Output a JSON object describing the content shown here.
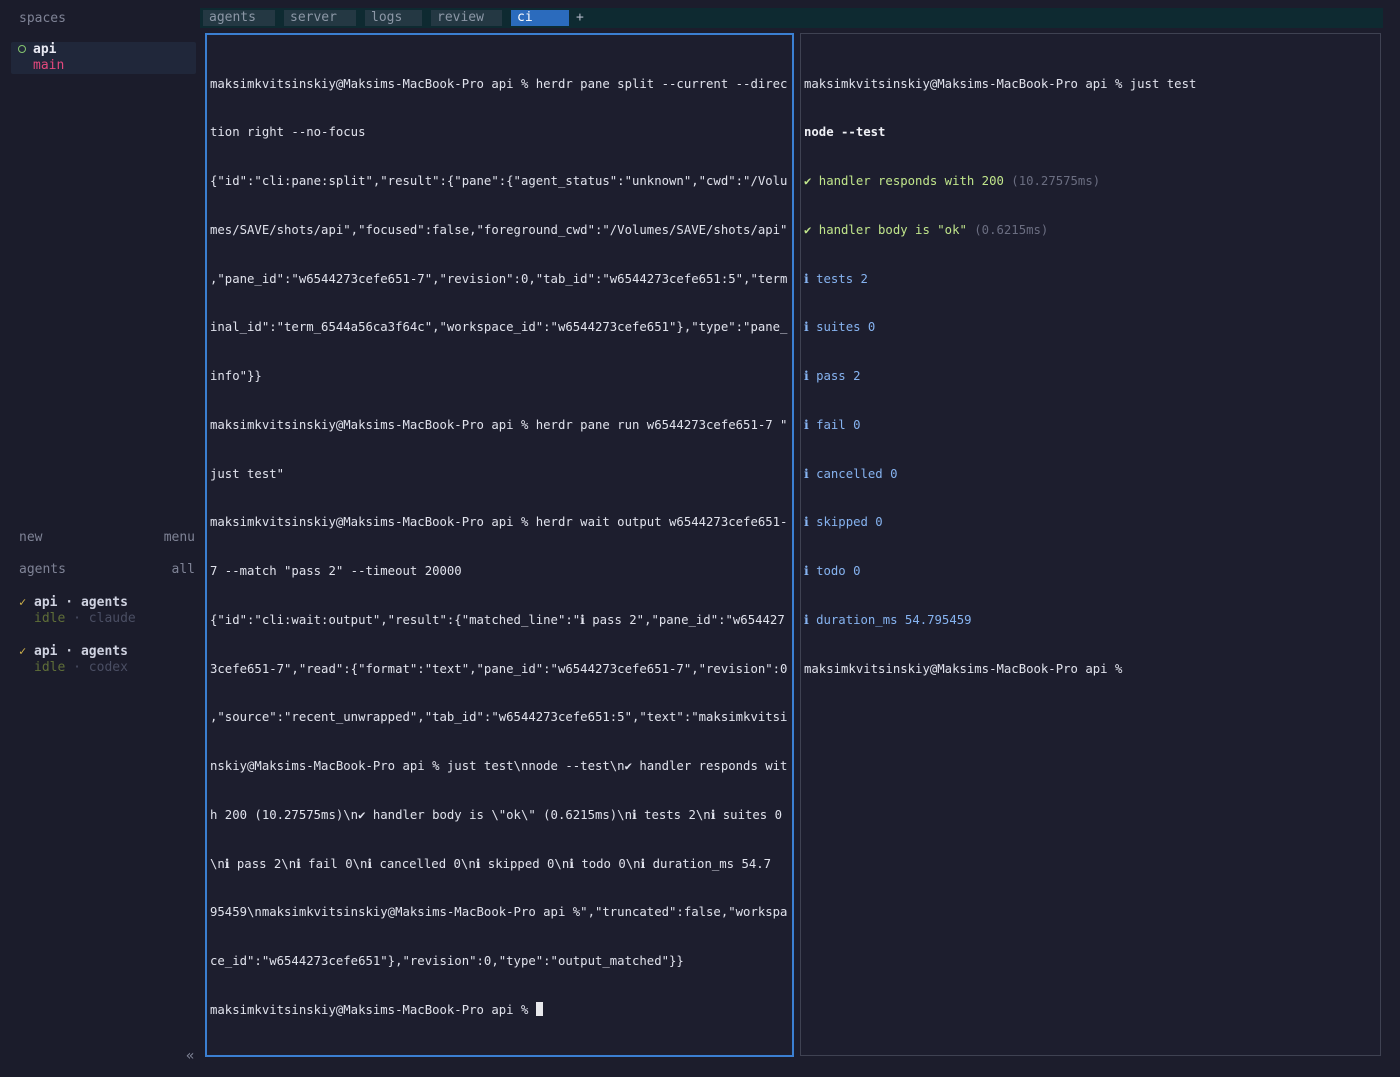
{
  "sidebar": {
    "spaces_heading": "spaces",
    "space": {
      "name": "api",
      "branch": "main"
    },
    "new_label": "new",
    "menu_label": "menu",
    "agents_heading": "agents",
    "all_label": "all",
    "agents": [
      {
        "check": "✓",
        "title": "api · agents",
        "status": "idle",
        "sep": " · ",
        "tool": "claude"
      },
      {
        "check": "✓",
        "title": "api · agents",
        "status": "idle",
        "sep": " · ",
        "tool": "codex"
      }
    ],
    "collapse_label": "«"
  },
  "tabs": [
    "agents",
    "server",
    "logs",
    "review",
    "ci"
  ],
  "active_tab": "ci",
  "add_tab_label": "+",
  "left_pane": {
    "lines": [
      "maksimkvitsinskiy@Maksims-MacBook-Pro api % herdr pane split --current --direc",
      "tion right --no-focus",
      "{\"id\":\"cli:pane:split\",\"result\":{\"pane\":{\"agent_status\":\"unknown\",\"cwd\":\"/Volu",
      "mes/SAVE/shots/api\",\"focused\":false,\"foreground_cwd\":\"/Volumes/SAVE/shots/api\"",
      ",\"pane_id\":\"w6544273cefe651-7\",\"revision\":0,\"tab_id\":\"w6544273cefe651:5\",\"term",
      "inal_id\":\"term_6544a56ca3f64c\",\"workspace_id\":\"w6544273cefe651\"},\"type\":\"pane_",
      "info\"}}",
      "maksimkvitsinskiy@Maksims-MacBook-Pro api % herdr pane run w6544273cefe651-7 \"",
      "just test\"",
      "maksimkvitsinskiy@Maksims-MacBook-Pro api % herdr wait output w6544273cefe651-",
      "7 --match \"pass 2\" --timeout 20000",
      "{\"id\":\"cli:wait:output\",\"result\":{\"matched_line\":\"ℹ pass 2\",\"pane_id\":\"w654427",
      "3cefe651-7\",\"read\":{\"format\":\"text\",\"pane_id\":\"w6544273cefe651-7\",\"revision\":0",
      ",\"source\":\"recent_unwrapped\",\"tab_id\":\"w6544273cefe651:5\",\"text\":\"maksimkvitsi",
      "nskiy@Maksims-MacBook-Pro api % just test\\nnode --test\\n✔ handler responds wit",
      "h 200 (10.27575ms)\\n✔ handler body is \\\"ok\\\" (0.6215ms)\\nℹ tests 2\\nℹ suites 0",
      "\\nℹ pass 2\\nℹ fail 0\\nℹ cancelled 0\\nℹ skipped 0\\nℹ todo 0\\nℹ duration_ms 54.7",
      "95459\\nmaksimkvitsinskiy@Maksims-MacBook-Pro api %\",\"truncated\":false,\"workspa",
      "ce_id\":\"w6544273cefe651\"},\"revision\":0,\"type\":\"output_matched\"}}"
    ],
    "prompt": "maksimkvitsinskiy@Maksims-MacBook-Pro api % "
  },
  "right_pane": {
    "command_line": "maksimkvitsinskiy@Maksims-MacBook-Pro api % just test",
    "runner_line": "node --test",
    "passes": [
      {
        "text": "✔ handler responds with 200",
        "time": "(10.27575ms)"
      },
      {
        "text": "✔ handler body is \"ok\"",
        "time": "(0.6215ms)"
      }
    ],
    "info_lines": [
      "ℹ tests 2",
      "ℹ suites 0",
      "ℹ pass 2",
      "ℹ fail 0",
      "ℹ cancelled 0",
      "ℹ skipped 0",
      "ℹ todo 0",
      "ℹ duration_ms 54.795459"
    ],
    "prompt": "maksimkvitsinskiy@Maksims-MacBook-Pro api %"
  },
  "colors": {
    "accent": "#3b7fd1",
    "active_tab": "#2b6bbd",
    "branch": "#e3487c",
    "pass": "#c0e58b",
    "info": "#86b3f0",
    "check": "#d0b34a"
  }
}
